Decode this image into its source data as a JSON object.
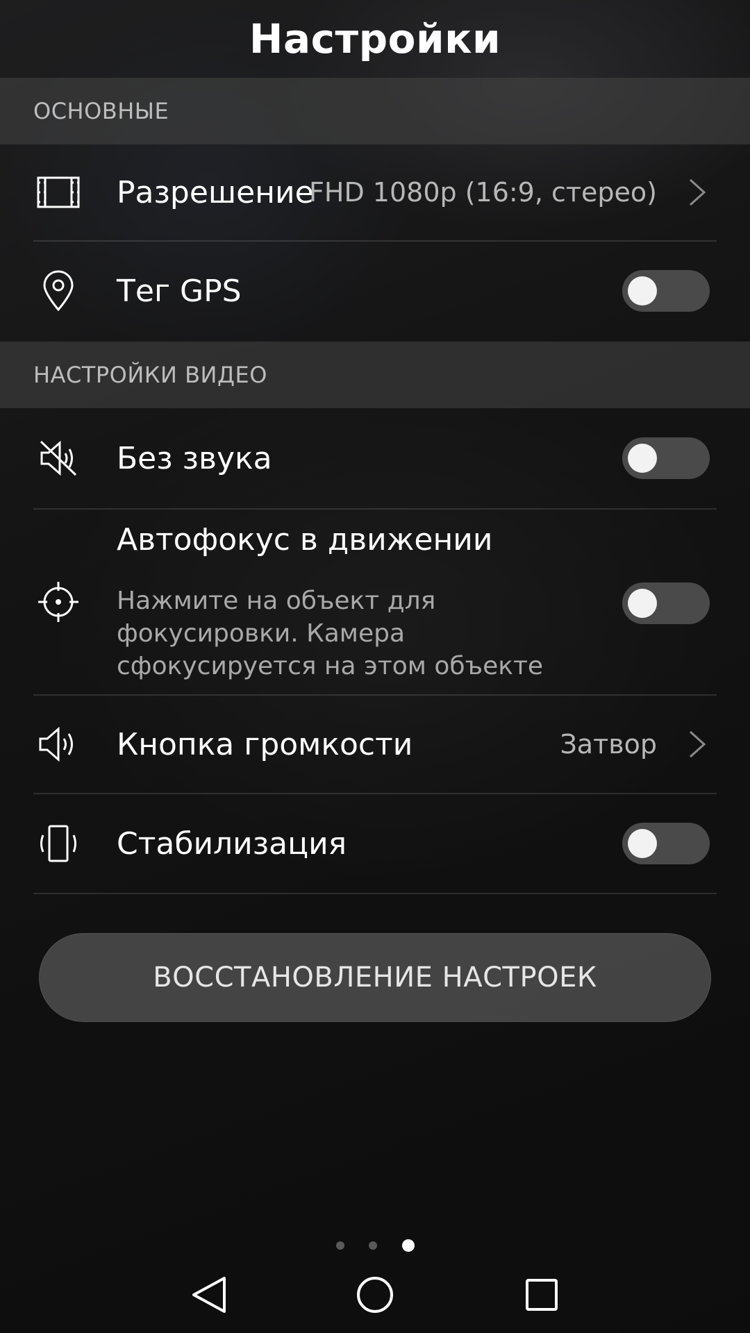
{
  "header": {
    "title": "Настройки"
  },
  "sections": {
    "general": {
      "header": "ОСНОВНЫЕ",
      "resolution": {
        "label": "Разрешение",
        "value": "FHD 1080p (16:9, стерео)"
      },
      "gps": {
        "label": "Тег GPS",
        "enabled": false
      }
    },
    "video": {
      "header": "НАСТРОЙКИ ВИДЕО",
      "mute": {
        "label": "Без звука",
        "enabled": false
      },
      "autofocus": {
        "label": "Автофокус в движении",
        "description": "Нажмите на объект для фокусировки. Камера сфокусируется на этом объекте",
        "enabled": false
      },
      "volume_key": {
        "label": "Кнопка громкости",
        "value": "Затвор"
      },
      "stabilization": {
        "label": "Стабилизация",
        "enabled": false
      }
    }
  },
  "reset_button": {
    "label": "ВОССТАНОВЛЕНИЕ НАСТРОЕК"
  },
  "page_indicator": {
    "count": 3,
    "active": 3
  },
  "icons": {
    "resolution": "film-frame-icon",
    "gps": "location-pin-icon",
    "mute": "speaker-muted-icon",
    "autofocus": "crosshair-icon",
    "volume_key": "speaker-icon",
    "stabilization": "phone-vibrate-icon",
    "nav_back": "back-triangle-icon",
    "nav_home": "home-circle-icon",
    "nav_recents": "recents-square-icon"
  },
  "colors": {
    "toggle_off_track": "#4a4a4a",
    "toggle_knob": "#f2f2f2",
    "section_header_text": "#bdbdbd",
    "secondary_text": "#b7b7b7"
  }
}
